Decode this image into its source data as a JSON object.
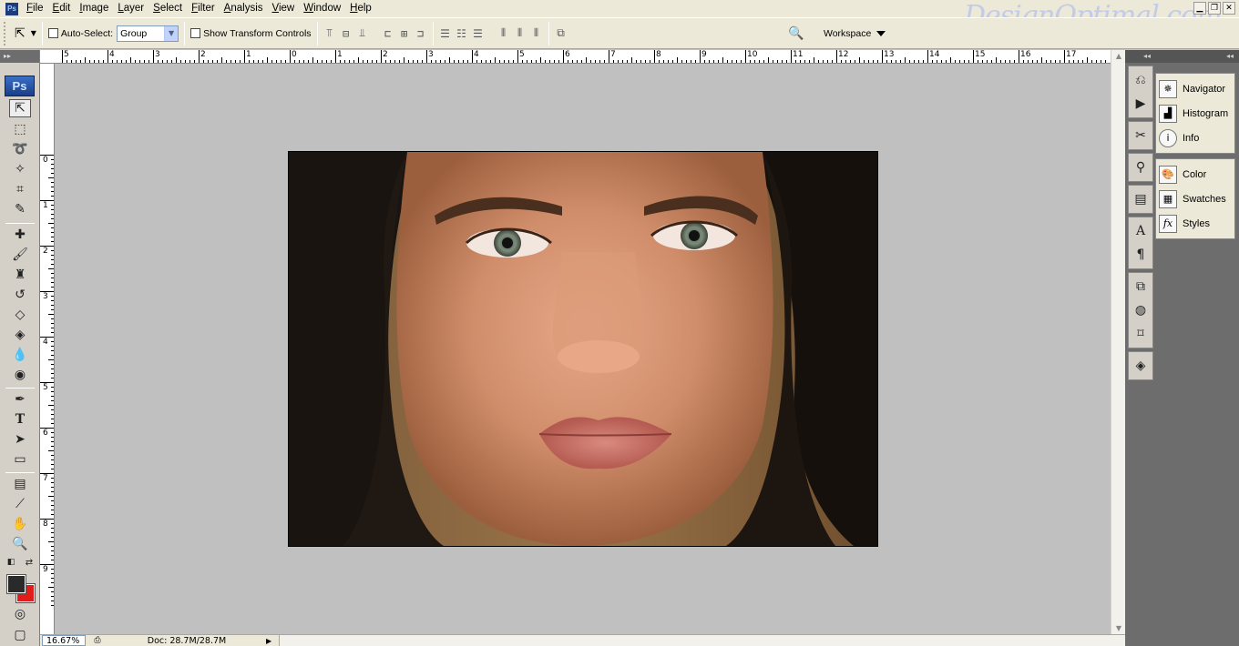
{
  "app": {
    "logo_text": "Ps",
    "watermark": "DesignOptimal.com"
  },
  "menubar": {
    "items": [
      "File",
      "Edit",
      "Image",
      "Layer",
      "Select",
      "Filter",
      "Analysis",
      "View",
      "Window",
      "Help"
    ]
  },
  "options": {
    "auto_select_label": "Auto-Select:",
    "auto_select_checked": false,
    "group_select_value": "Group",
    "show_transform_label": "Show Transform Controls",
    "show_transform_checked": false,
    "workspace_label": "Workspace"
  },
  "toolbox": {
    "badge": "Ps",
    "tools": [
      "move-tool",
      "marquee-tool",
      "lasso-tool",
      "magic-wand-tool",
      "crop-tool",
      "slice-tool",
      "healing-brush-tool",
      "brush-tool",
      "clone-stamp-tool",
      "history-brush-tool",
      "eraser-tool",
      "paint-bucket-tool",
      "blur-tool",
      "dodge-tool",
      "pen-tool",
      "type-tool",
      "path-selection-tool",
      "rectangle-tool",
      "notes-tool",
      "eyedropper-tool",
      "hand-tool",
      "zoom-tool"
    ],
    "foreground_color": "#2a2a2a",
    "background_color": "#e21b1b"
  },
  "rulers": {
    "top_labels": [
      "5",
      "4",
      "3",
      "2",
      "1",
      "0",
      "1",
      "2",
      "3",
      "4",
      "5",
      "6",
      "7",
      "8",
      "9",
      "10",
      "11",
      "12",
      "13",
      "14",
      "15",
      "16",
      "17"
    ],
    "left_labels": [
      "0",
      "1",
      "2",
      "3",
      "4",
      "5",
      "6",
      "7",
      "8",
      "9"
    ]
  },
  "status": {
    "zoom": "16.67%",
    "doc": "Doc: 28.7M/28.7M"
  },
  "dock": {
    "panel_groups": [
      {
        "items": [
          {
            "label": "Navigator",
            "icon": "navigator-icon"
          },
          {
            "label": "Histogram",
            "icon": "histogram-icon"
          },
          {
            "label": "Info",
            "icon": "info-icon"
          }
        ]
      },
      {
        "items": [
          {
            "label": "Color",
            "icon": "color-palette-icon"
          },
          {
            "label": "Swatches",
            "icon": "swatches-icon"
          },
          {
            "label": "Styles",
            "icon": "styles-icon"
          }
        ]
      }
    ]
  }
}
